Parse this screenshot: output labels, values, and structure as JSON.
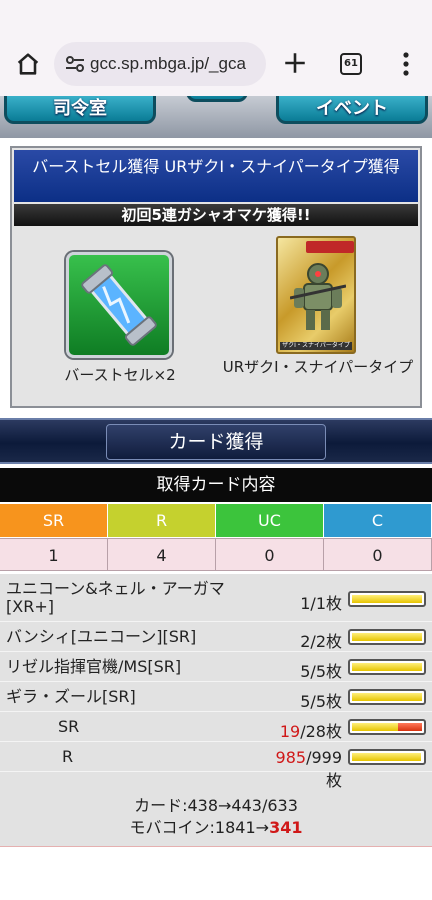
{
  "browser": {
    "url": "gcc.sp.mbga.jp/_gca",
    "tab_count": "61",
    "icons": [
      "home-icon",
      "site-settings-icon",
      "new-tab-icon",
      "tab-switcher-icon",
      "more-menu-icon"
    ]
  },
  "nav": {
    "left_label": "司令室",
    "right_label": "イベント"
  },
  "bonus": {
    "title": "バーストセル獲得 URザクI・スナイパータイプ獲得",
    "subtitle": "初回5連ガシャオマケ獲得!!",
    "item1_label": "バーストセル×2",
    "item2_label": "URザクI・スナイパータイプ",
    "card_caption": "ザクI・スナイパータイプ"
  },
  "card_get": {
    "header": "カード獲得"
  },
  "summary": {
    "heading": "取得カード内容",
    "rarities": [
      {
        "label": "SR",
        "count": "1",
        "color": "#f7941d"
      },
      {
        "label": "R",
        "count": "4",
        "color": "#c5d12e"
      },
      {
        "label": "UC",
        "count": "0",
        "color": "#3cc43c"
      },
      {
        "label": "C",
        "count": "0",
        "color": "#2f9ad0"
      }
    ]
  },
  "cards": [
    {
      "name_line1": "ユニコーン&ネェル・アーガマ",
      "name_line2": "[XR+]",
      "count_owned": "1",
      "count_total": "/1枚",
      "fill": 1.0
    },
    {
      "name_line1": "バンシィ[ユニコーン][SR]",
      "name_line2": "",
      "count_owned": "2",
      "count_total": "/2枚",
      "fill": 1.0
    },
    {
      "name_line1": "リゼル指揮官機/MS[SR]",
      "name_line2": "",
      "count_owned": "5",
      "count_total": "/5枚",
      "fill": 1.0
    },
    {
      "name_line1": "ギラ・ズール[SR]",
      "name_line2": "",
      "count_owned": "5",
      "count_total": "/5枚",
      "fill": 1.0
    }
  ],
  "totals": [
    {
      "label": "SR",
      "count_owned": "19",
      "count_total": "/28枚",
      "fill": 0.68
    },
    {
      "label": "R",
      "count_owned": "985",
      "count_total": "/999枚",
      "fill": 0.986
    }
  ],
  "footer": {
    "cards_line": "カード:438→443/633",
    "coin_prefix": "モバコイン:1841→",
    "coin_value": "341"
  }
}
